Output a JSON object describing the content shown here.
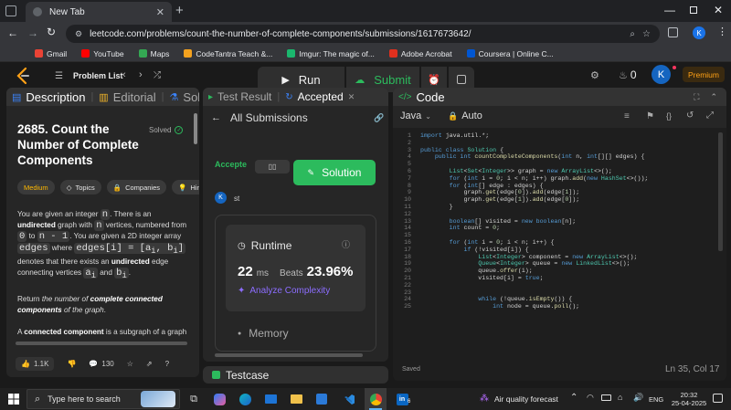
{
  "browser": {
    "tab_title": "New Tab",
    "url": "leetcode.com/problems/count-the-number-of-complete-components/submissions/1617673642/",
    "profile_initial": "K",
    "bookmarks": [
      {
        "label": "Gmail",
        "color": "#ea4335"
      },
      {
        "label": "YouTube",
        "color": "#ff0000"
      },
      {
        "label": "Maps",
        "color": "#34a853"
      },
      {
        "label": "CodeTantra Teach &...",
        "color": "#f4a21f"
      },
      {
        "label": "Imgur: The magic of...",
        "color": "#1bb76e"
      },
      {
        "label": "Adobe Acrobat",
        "color": "#e0301e"
      },
      {
        "label": "Coursera | Online C...",
        "color": "#0056d2"
      }
    ]
  },
  "nav": {
    "problem_list": "Problem List",
    "run": "Run",
    "submit": "Submit",
    "streak": "0",
    "avatar": "K",
    "premium": "Premium"
  },
  "description": {
    "tabs": [
      "Description",
      "Editorial",
      "Solu"
    ],
    "title": "2685. Count the Number of Complete Components",
    "status": "Solved",
    "chips": [
      "Medium",
      "Topics",
      "Companies",
      "Hint"
    ],
    "likes": "1.1K",
    "comments": "130"
  },
  "submission": {
    "tabs": [
      "Test Result",
      "Accepted"
    ],
    "header": "All Submissions",
    "status_short": "Accepte",
    "solution_btn": "Solution",
    "user_short": "st",
    "runtime_label": "Runtime",
    "runtime_value": "22",
    "runtime_unit": "ms",
    "beats_label": "Beats",
    "beats_value": "23.96%",
    "analyze": "Analyze Complexity",
    "memory_label": "Memory",
    "testcase": "Testcase"
  },
  "code": {
    "title": "Code",
    "language": "Java",
    "mode": "Auto",
    "saved": "Saved",
    "cursor": "Ln 35, Col 17"
  },
  "taskbar": {
    "search_placeholder": "Type here to search",
    "weather": "Air quality forecast",
    "lang": "ENG",
    "time": "20:32",
    "date": "25-04-2025",
    "linkedin_badge": "6"
  },
  "colors": {
    "accent_green": "#2cbb5d",
    "leetcode_orange": "#ffa116",
    "medium_yellow": "#ffb800",
    "analyze_purple": "#8c6dff"
  }
}
